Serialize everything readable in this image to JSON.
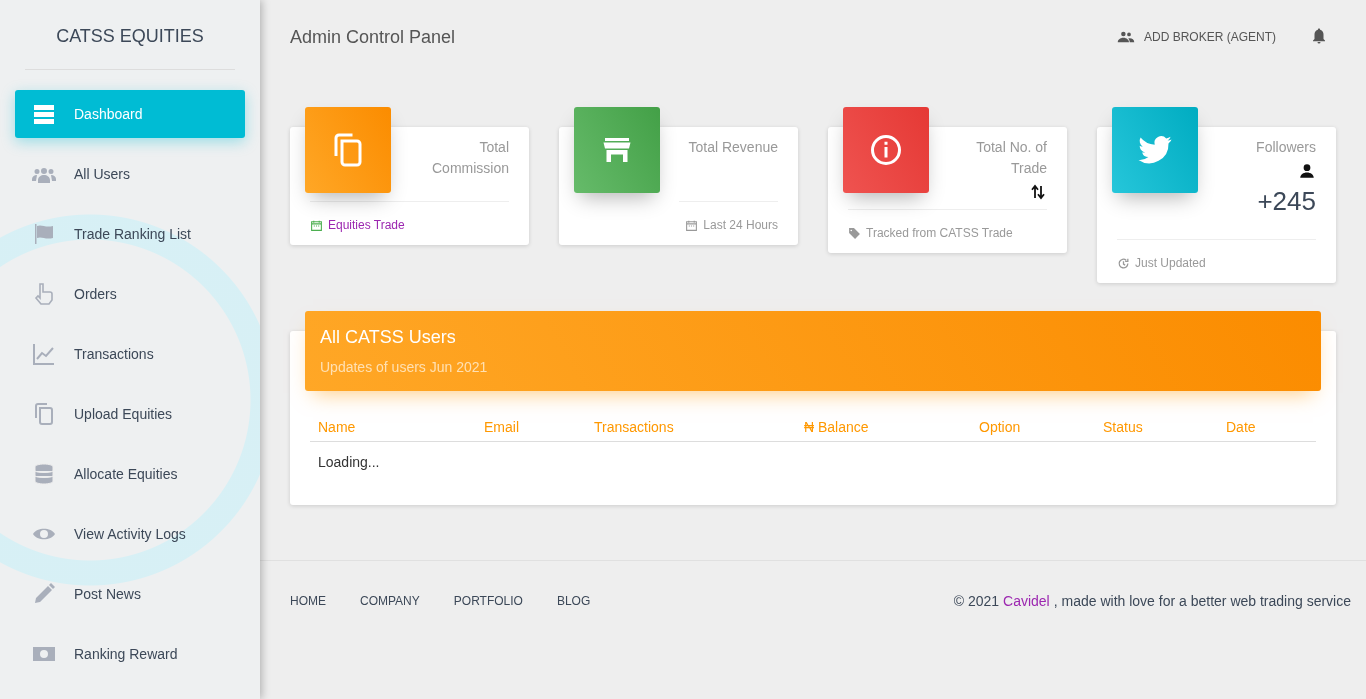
{
  "sidebar": {
    "brand": "CATSS EQUITIES",
    "items": [
      {
        "label": "Dashboard",
        "kind": "dashboard",
        "selected": true
      },
      {
        "label": "All Users",
        "kind": "users",
        "selected": false
      },
      {
        "label": "Trade Ranking List",
        "kind": "flag",
        "selected": false
      },
      {
        "label": "Orders",
        "kind": "hand",
        "selected": false
      },
      {
        "label": "Transactions",
        "kind": "chart",
        "selected": false
      },
      {
        "label": "Upload Equities",
        "kind": "copy",
        "selected": false
      },
      {
        "label": "Allocate Equities",
        "kind": "database",
        "selected": false
      },
      {
        "label": "View Activity Logs",
        "kind": "eye",
        "selected": false
      },
      {
        "label": "Post News",
        "kind": "pencil",
        "selected": false
      },
      {
        "label": "Ranking Reward",
        "kind": "money",
        "selected": false
      }
    ]
  },
  "header": {
    "title": "Admin Control Panel",
    "action": "ADD BROKER (AGENT)"
  },
  "stats": [
    {
      "kind": "commission",
      "color": "#fb8c00",
      "title": "Total Commission",
      "footer": {
        "kind": "calendar",
        "text": "Equities Trade",
        "highlight": true
      }
    },
    {
      "kind": "revenue",
      "color": "#43a047",
      "title": "Total Revenue",
      "footer": {
        "kind": "calendar",
        "text": "Last 24 Hours",
        "highlight": false
      }
    },
    {
      "kind": "trades",
      "color": "#e53935",
      "title": "Total No. of Trade",
      "footer": {
        "kind": "tag",
        "text": "Tracked from CATSS Trade",
        "highlight": false
      }
    },
    {
      "kind": "followers",
      "color": "#00acc1",
      "title": "Followers",
      "value": "+245",
      "footer": {
        "kind": "refresh",
        "text": "Just Updated",
        "highlight": false
      }
    }
  ],
  "users_table": {
    "title": "All CATSS Users",
    "subtitle": "Updates of users Jun 2021",
    "columns": [
      "Name",
      "Email",
      "Transactions",
      "₦ Balance",
      "Option",
      "Status",
      "Date"
    ],
    "status_text": "Loading..."
  },
  "footer": {
    "links": [
      "HOME",
      "COMPANY",
      "PORTFOLIO",
      "BLOG"
    ],
    "copyright_prefix": "© 2021",
    "copyright_link": "Cavidel",
    "copyright_suffix": ", made with love for a better web trading service"
  }
}
